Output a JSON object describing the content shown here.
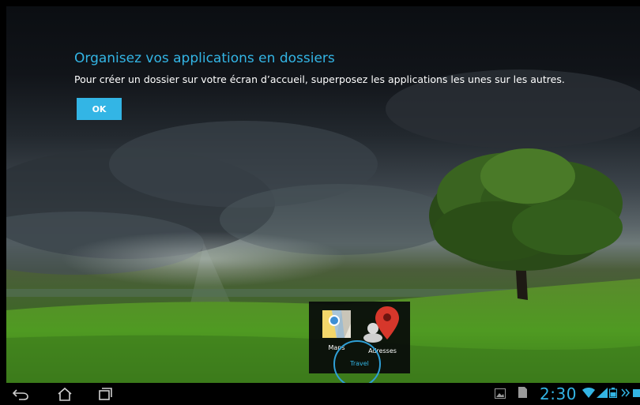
{
  "overlay": {
    "title": "Organisez vos applications en dossiers",
    "description": "Pour créer un dossier sur votre écran d’accueil, superposez les applications les unes sur les autres.",
    "ok_label": "OK"
  },
  "folder": {
    "name": "Travel",
    "apps": [
      {
        "label": "Maps",
        "icon": "maps-icon"
      },
      {
        "label": "Adresses",
        "icon": "places-icon"
      }
    ]
  },
  "status_bar": {
    "time": "2:30",
    "icons": [
      "gallery-notification-icon",
      "sd-card-icon",
      "wifi-icon",
      "signal-icon",
      "battery-icon"
    ]
  },
  "nav_bar": {
    "icons": [
      "back-icon",
      "home-icon",
      "recent-apps-icon"
    ]
  },
  "colors": {
    "accent": "#33b5e5",
    "button_bg": "#33b5e5"
  }
}
